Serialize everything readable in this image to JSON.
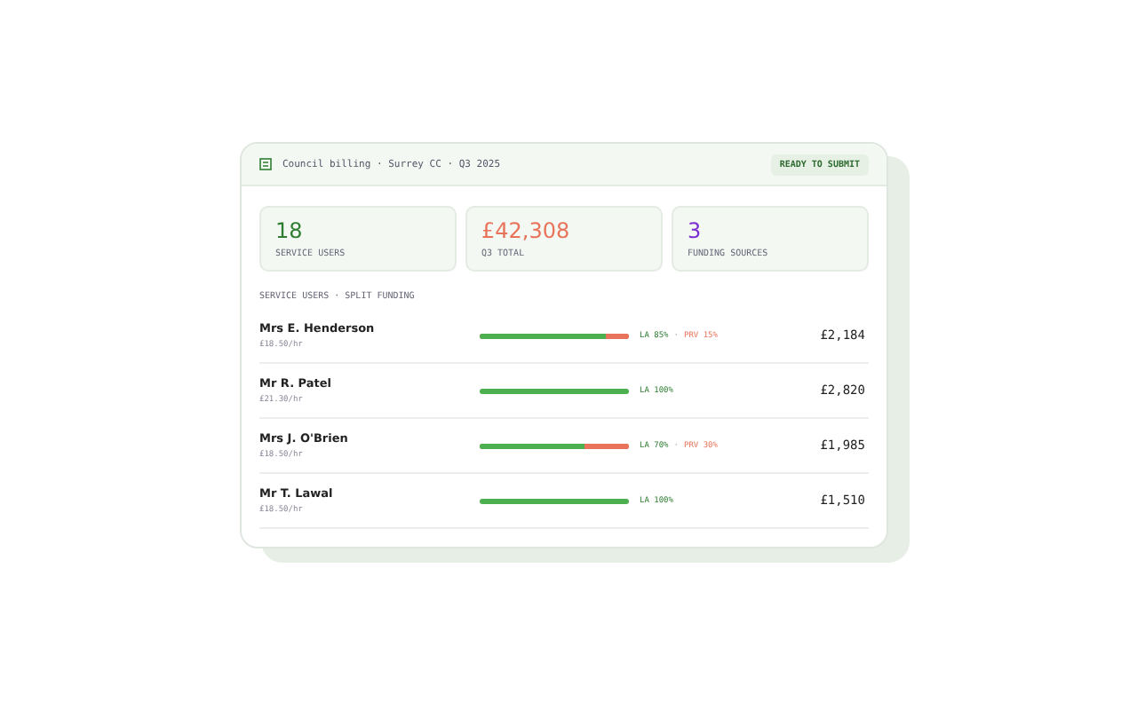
{
  "header": {
    "breadcrumb": "Council billing · Surrey CC · Q3 2025",
    "badge": "READY TO SUBMIT"
  },
  "stats": [
    {
      "value": "18",
      "label": "SERVICE USERS",
      "color": "#2e7d32"
    },
    {
      "value": "£42,308",
      "label": "Q3 TOTAL",
      "color": "#e8735a"
    },
    {
      "value": "3",
      "label": "FUNDING SOURCES",
      "color": "#7b2fd0"
    }
  ],
  "separator": "·",
  "section_title": "SERVICE USERS · SPLIT FUNDING",
  "rows": [
    {
      "name": "Mrs E. Henderson",
      "rate": "£18.50/hr",
      "level": 0.85,
      "split": [
        {
          "label": "LA 85%",
          "kind": "la"
        },
        {
          "label": "PRV 15%",
          "kind": "private"
        }
      ],
      "amount": "£2,184"
    },
    {
      "name": "Mr R. Patel",
      "rate": "£21.30/hr",
      "level": 1,
      "split": [
        {
          "label": "LA 100%",
          "kind": "la"
        }
      ],
      "amount": "£2,820"
    },
    {
      "name": "Mrs J. O'Brien",
      "rate": "£18.50/hr",
      "level": 0.7,
      "split": [
        {
          "label": "LA 70%",
          "kind": "la"
        },
        {
          "label": "PRV 30%",
          "kind": "private"
        }
      ],
      "amount": "£1,985"
    },
    {
      "name": "Mr T. Lawal",
      "rate": "£18.50/hr",
      "level": 1,
      "split": [
        {
          "label": "LA 100%",
          "kind": "la"
        }
      ],
      "amount": "£1,510"
    }
  ]
}
